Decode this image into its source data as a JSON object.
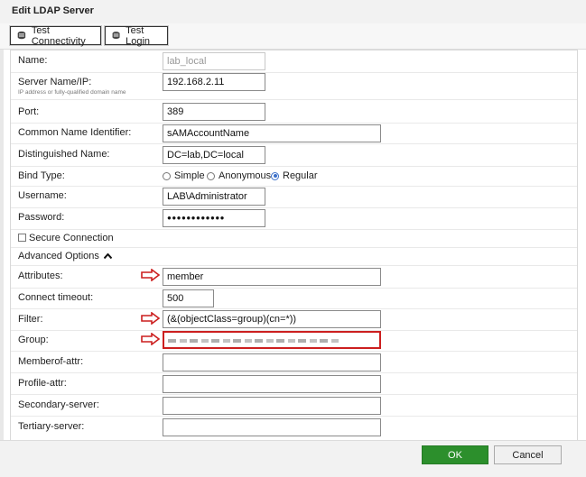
{
  "dialog": {
    "title": "Edit LDAP Server"
  },
  "toolbar": {
    "test_connectivity": "Test Connectivity",
    "test_login": "Test Login"
  },
  "fields": {
    "name": {
      "label": "Name:",
      "value": "lab_local"
    },
    "server": {
      "label": "Server Name/IP:",
      "hint": "IP address or fully-qualified domain name",
      "value": "192.168.2.11"
    },
    "port": {
      "label": "Port:",
      "value": "389"
    },
    "cni": {
      "label": "Common Name Identifier:",
      "value": "sAMAccountName"
    },
    "dn": {
      "label": "Distinguished Name:",
      "value": "DC=lab,DC=local"
    },
    "bind": {
      "label": "Bind Type:",
      "options": [
        "Simple",
        "Anonymous",
        "Regular"
      ],
      "selected": "Regular"
    },
    "username": {
      "label": "Username:",
      "value": "LAB\\Administrator"
    },
    "password": {
      "label": "Password:",
      "value": "●●●●●●●●●●●●"
    },
    "secure": {
      "label": "Secure Connection",
      "checked": false
    },
    "advanced": {
      "label": "Advanced Options",
      "expanded": true
    },
    "attributes": {
      "label": "Attributes:",
      "value": "member"
    },
    "timeout": {
      "label": "Connect timeout:",
      "value": "500"
    },
    "filter": {
      "label": "Filter:",
      "value": "(&(objectClass=group)(cn=*))"
    },
    "group": {
      "label": "Group:",
      "value": ""
    },
    "memberof": {
      "label": "Memberof-attr:",
      "value": ""
    },
    "profile": {
      "label": "Profile-attr:",
      "value": ""
    },
    "secondary": {
      "label": "Secondary-server:",
      "value": ""
    },
    "tertiary": {
      "label": "Tertiary-server:",
      "value": ""
    }
  },
  "buttons": {
    "ok": "OK",
    "cancel": "Cancel"
  },
  "colors": {
    "ok_bg": "#2c8f2c",
    "highlight": "#cc1f1f",
    "radio_selected": "#3a6fc9"
  }
}
